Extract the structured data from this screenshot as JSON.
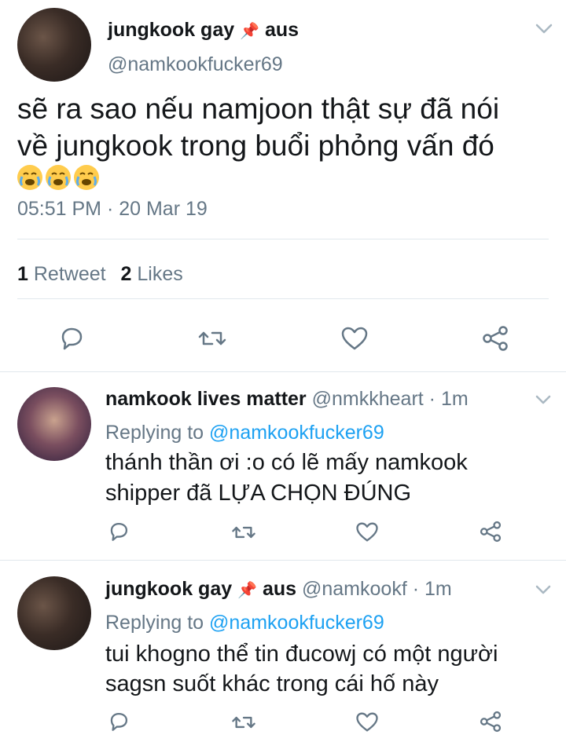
{
  "main_tweet": {
    "display_name": "jungkook gay",
    "pin_emoji": "📌",
    "location": "aus",
    "handle": "@namkookfucker69",
    "text_line1": "sẽ ra sao nếu namjoon thật sự đã nói",
    "text_line2": "về jungkook trong buổi phỏng vấn đó",
    "emojis": [
      "crying-face",
      "crying-face",
      "crying-face"
    ],
    "timestamp": "05:51 PM · 20 Mar 19",
    "retweet_count": "1",
    "retweet_label": "Retweet",
    "like_count": "2",
    "like_label": "Likes"
  },
  "replies": [
    {
      "display_name": "namkook lives matter",
      "handle": "@nmkkheart",
      "time": "· 1m",
      "replying_prefix": "Replying to",
      "replying_handle": "@namkookfucker69",
      "text_line1": "thánh thần ơi :o có lẽ mấy namkook",
      "text_line2": "shipper đã LỰA CHỌN ĐÚNG"
    },
    {
      "display_name": "jungkook gay",
      "pin_emoji": "📌",
      "location": "aus",
      "handle": "@namkookf",
      "time": "· 1m",
      "replying_prefix": "Replying to",
      "replying_handle": "@namkookfucker69",
      "text_line1": "tui khogno thể tin đucowj có một người",
      "text_line2": "sagsn suốt khác trong cái hố này"
    }
  ],
  "colors": {
    "link": "#1da1f2",
    "muted": "#657786",
    "divider": "#e1e8ed",
    "text": "#14171a"
  },
  "icons": [
    "reply-icon",
    "retweet-icon",
    "heart-icon",
    "share-icon",
    "chevron-down-icon"
  ]
}
